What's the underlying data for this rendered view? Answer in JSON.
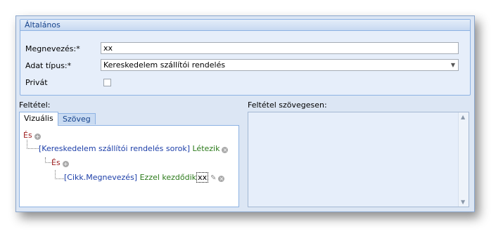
{
  "general": {
    "title": "Általános",
    "name_label": "Megnevezés:*",
    "name_value": "xx",
    "type_label": "Adat típus:*",
    "type_value": "Kereskedelem szállítói rendelés",
    "private_label": "Privát"
  },
  "condition": {
    "label": "Feltétel:",
    "tabs": [
      {
        "label": "Vizuális"
      },
      {
        "label": "Szöveg"
      }
    ],
    "tree": {
      "and1": "És",
      "field1": "[Kereskedelem szállítói rendelés sorok]",
      "op1": "Létezik",
      "and2": "És",
      "field2": "[Cikk.Megnevezés]",
      "op2": "Ezzel kezdődik",
      "value2": "xx"
    }
  },
  "text_condition": {
    "label": "Feltétel szövegesen:"
  }
}
